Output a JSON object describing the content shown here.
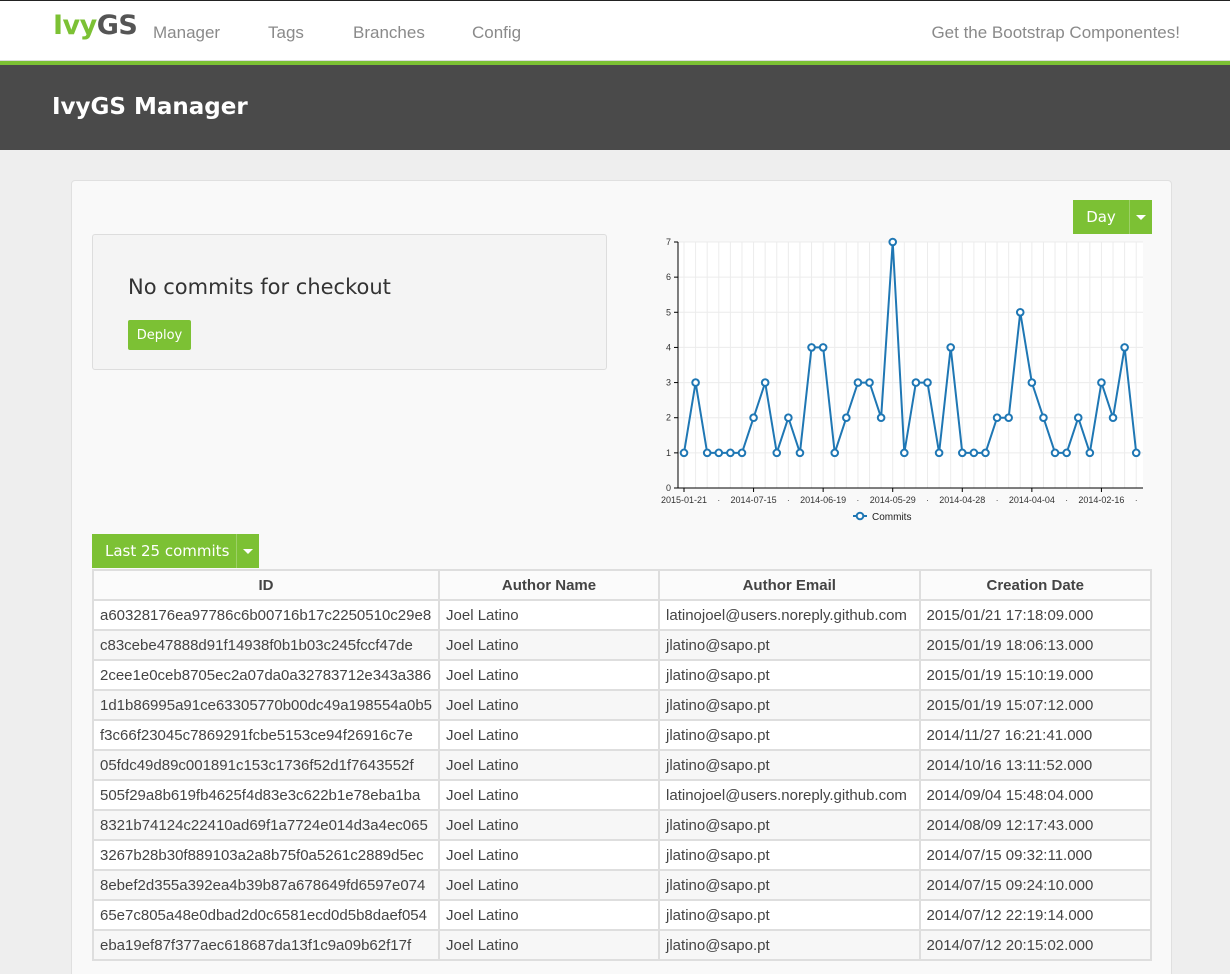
{
  "brand": {
    "part1": "Ivy",
    "part2": "GS"
  },
  "nav": {
    "items": [
      {
        "label": "Manager"
      },
      {
        "label": "Tags"
      },
      {
        "label": "Branches"
      },
      {
        "label": "Config"
      }
    ],
    "right_link": "Get the Bootstrap Componentes!"
  },
  "header": {
    "title": "IvyGS Manager"
  },
  "period_select": {
    "label": "Day"
  },
  "checkout": {
    "message": "No commits for checkout",
    "deploy_label": "Deploy"
  },
  "commits_select": {
    "label": "Last 25 commits"
  },
  "chart_data": {
    "type": "line",
    "series": [
      {
        "name": "Commits",
        "values": [
          1,
          3,
          1,
          1,
          1,
          1,
          2,
          3,
          1,
          2,
          1,
          4,
          4,
          1,
          2,
          3,
          3,
          2,
          7,
          1,
          3,
          3,
          1,
          4,
          1,
          1,
          1,
          2,
          2,
          5,
          3,
          2,
          1,
          1,
          2,
          1,
          3,
          2,
          4,
          1
        ]
      }
    ],
    "x_tick_labels": [
      "2015-01-21",
      "2014-07-15",
      "2014-06-19",
      "2014-05-29",
      "2014-04-28",
      "2014-04-04",
      "2014-02-16"
    ],
    "ylim": [
      0,
      7
    ],
    "y_ticks": [
      0,
      1,
      2,
      3,
      4,
      5,
      6,
      7
    ],
    "grid": true,
    "legend": "bottom",
    "color": "#1f77b4"
  },
  "table": {
    "headers": [
      "ID",
      "Author Name",
      "Author Email",
      "Creation Date"
    ],
    "rows": [
      [
        "a60328176ea97786c6b00716b17c2250510c29e8",
        "Joel Latino",
        "latinojoel@users.noreply.github.com",
        "2015/01/21 17:18:09.000"
      ],
      [
        "c83cebe47888d91f14938f0b1b03c245fccf47de",
        "Joel Latino",
        "jlatino@sapo.pt",
        "2015/01/19 18:06:13.000"
      ],
      [
        "2cee1e0ceb8705ec2a07da0a32783712e343a386",
        "Joel Latino",
        "jlatino@sapo.pt",
        "2015/01/19 15:10:19.000"
      ],
      [
        "1d1b86995a91ce63305770b00dc49a198554a0b5",
        "Joel Latino",
        "jlatino@sapo.pt",
        "2015/01/19 15:07:12.000"
      ],
      [
        "f3c66f23045c7869291fcbe5153ce94f26916c7e",
        "Joel Latino",
        "jlatino@sapo.pt",
        "2014/11/27 16:21:41.000"
      ],
      [
        "05fdc49d89c001891c153c1736f52d1f7643552f",
        "Joel Latino",
        "jlatino@sapo.pt",
        "2014/10/16 13:11:52.000"
      ],
      [
        "505f29a8b619fb4625f4d83e3c622b1e78eba1ba",
        "Joel Latino",
        "latinojoel@users.noreply.github.com",
        "2014/09/04 15:48:04.000"
      ],
      [
        "8321b74124c22410ad69f1a7724e014d3a4ec065",
        "Joel Latino",
        "jlatino@sapo.pt",
        "2014/08/09 12:17:43.000"
      ],
      [
        "3267b28b30f889103a2a8b75f0a5261c2889d5ec",
        "Joel Latino",
        "jlatino@sapo.pt",
        "2014/07/15 09:32:11.000"
      ],
      [
        "8ebef2d355a392ea4b39b87a678649fd6597e074",
        "Joel Latino",
        "jlatino@sapo.pt",
        "2014/07/15 09:24:10.000"
      ],
      [
        "65e7c805a48e0dbad2d0c6581ecd0d5b8daef054",
        "Joel Latino",
        "jlatino@sapo.pt",
        "2014/07/12 22:19:14.000"
      ],
      [
        "eba19ef87f377aec618687da13f1c9a09b62f17f",
        "Joel Latino",
        "jlatino@sapo.pt",
        "2014/07/12 20:15:02.000"
      ]
    ]
  }
}
